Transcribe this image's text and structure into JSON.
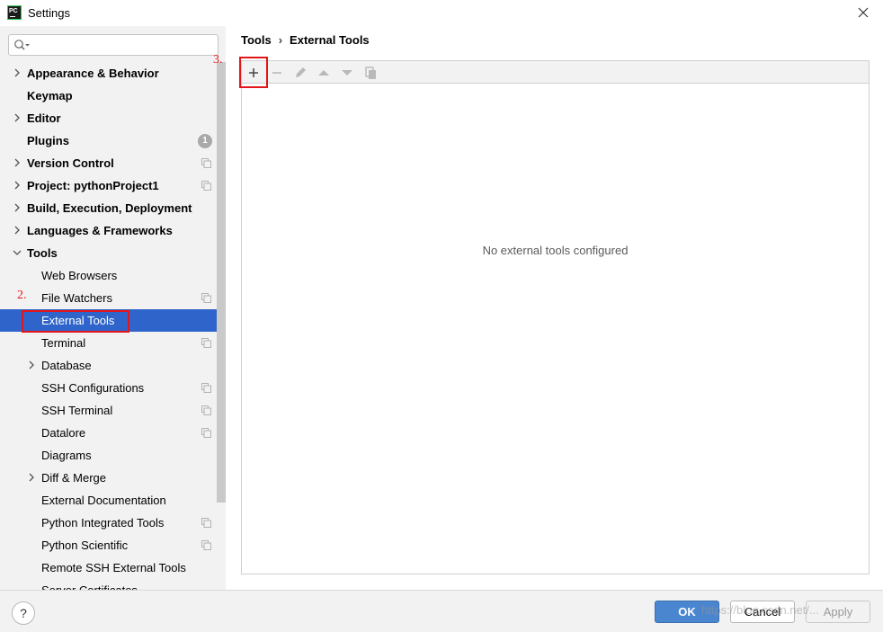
{
  "window": {
    "title": "Settings",
    "logo_text": "PC"
  },
  "search": {
    "placeholder": ""
  },
  "sidebar": {
    "items": [
      {
        "label": "Appearance & Behavior",
        "level": 0,
        "arrow": "right"
      },
      {
        "label": "Keymap",
        "level": 0
      },
      {
        "label": "Editor",
        "level": 0,
        "arrow": "right"
      },
      {
        "label": "Plugins",
        "level": 0,
        "badge": "1"
      },
      {
        "label": "Version Control",
        "level": 0,
        "arrow": "right",
        "copy": true
      },
      {
        "label": "Project: pythonProject1",
        "level": 0,
        "arrow": "right",
        "copy": true
      },
      {
        "label": "Build, Execution, Deployment",
        "level": 0,
        "arrow": "right"
      },
      {
        "label": "Languages & Frameworks",
        "level": 0,
        "arrow": "right"
      },
      {
        "label": "Tools",
        "level": 0,
        "arrow": "down"
      },
      {
        "label": "Web Browsers",
        "level": 1
      },
      {
        "label": "File Watchers",
        "level": 1,
        "copy": true
      },
      {
        "label": "External Tools",
        "level": 1,
        "selected": true
      },
      {
        "label": "Terminal",
        "level": 1,
        "copy": true
      },
      {
        "label": "Database",
        "level": 1,
        "arrow": "right"
      },
      {
        "label": "SSH Configurations",
        "level": 1,
        "copy": true
      },
      {
        "label": "SSH Terminal",
        "level": 1,
        "copy": true
      },
      {
        "label": "Datalore",
        "level": 1,
        "copy": true
      },
      {
        "label": "Diagrams",
        "level": 1
      },
      {
        "label": "Diff & Merge",
        "level": 1,
        "arrow": "right"
      },
      {
        "label": "External Documentation",
        "level": 1
      },
      {
        "label": "Python Integrated Tools",
        "level": 1,
        "copy": true
      },
      {
        "label": "Python Scientific",
        "level": 1,
        "copy": true
      },
      {
        "label": "Remote SSH External Tools",
        "level": 1
      },
      {
        "label": "Server Certificates",
        "level": 1
      }
    ]
  },
  "breadcrumb": {
    "parent": "Tools",
    "separator": "›",
    "current": "External Tools"
  },
  "toolbar": {
    "buttons": [
      "add-icon",
      "remove-icon",
      "edit-icon",
      "move-up-icon",
      "move-down-icon",
      "copy-icon"
    ]
  },
  "main": {
    "empty_text": "No external tools configured"
  },
  "annotations": {
    "step2": "2.",
    "step3": "3."
  },
  "footer": {
    "help_label": "?",
    "ok_label": "OK",
    "cancel_label": "Cancel",
    "apply_label": "Apply",
    "watermark": "https://blog.csdn.net/..."
  },
  "colors": {
    "selection": "#2f65ca",
    "annotation": "#e0161b",
    "ok_button": "#4a86cf"
  }
}
